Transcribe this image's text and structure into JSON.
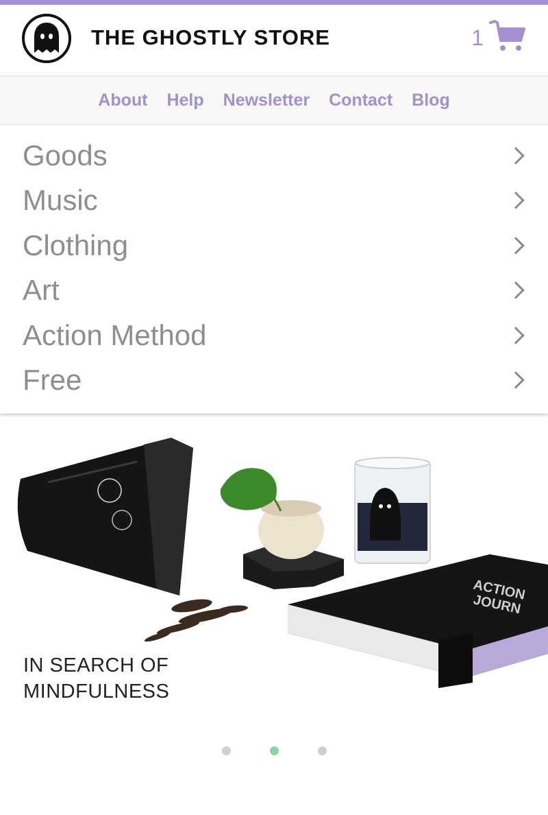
{
  "brand": {
    "name": "THE GHOSTLY STORE",
    "accent_color": "#a48fcf"
  },
  "cart": {
    "count": "1",
    "icon": "shopping-cart-icon"
  },
  "nav": {
    "links": [
      "About",
      "Help",
      "Newsletter",
      "Contact",
      "Blog"
    ]
  },
  "menu": {
    "items": [
      {
        "label": "Goods",
        "icon": "chevron-right-icon"
      },
      {
        "label": "Music",
        "icon": "chevron-right-icon"
      },
      {
        "label": "Clothing",
        "icon": "chevron-right-icon"
      },
      {
        "label": "Art",
        "icon": "chevron-right-icon"
      },
      {
        "label": "Action Method",
        "icon": "chevron-right-icon"
      },
      {
        "label": "Free",
        "icon": "chevron-right-icon"
      }
    ]
  },
  "hero": {
    "caption_line1": "IN SEARCH OF",
    "caption_line2": "MINDFULNESS",
    "carousel": {
      "total_slides": 3,
      "active_index": 1,
      "active_color": "#88d4a6"
    }
  }
}
